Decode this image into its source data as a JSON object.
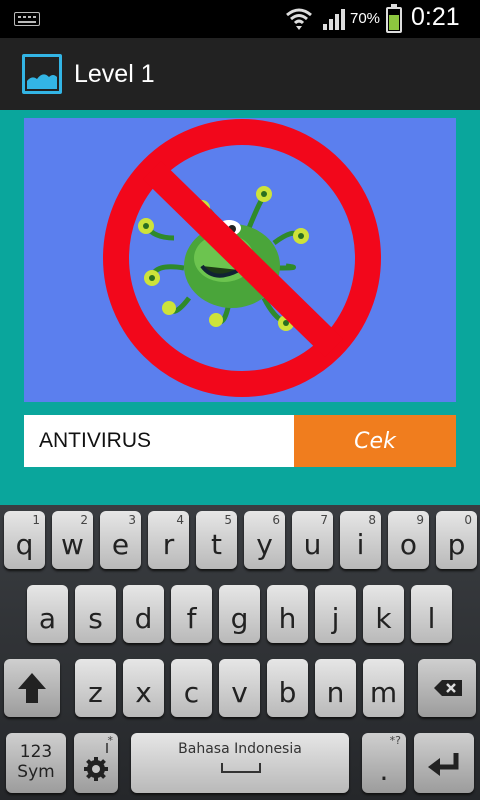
{
  "status_bar": {
    "battery_percent": "70%",
    "battery_level": 0.7,
    "time": "0:21",
    "icons": [
      "keyboard-icon",
      "wifi-icon",
      "signal-icon",
      "battery-icon"
    ]
  },
  "action_bar": {
    "title": "Level 1",
    "icon": "image-icon"
  },
  "puzzle": {
    "image": "no-virus-sign",
    "answer_value": "ANTIVIRUS",
    "check_label": "Cek",
    "colors": {
      "panel": "#5b7fee",
      "background": "#0aa69c",
      "button": "#f07d1e"
    }
  },
  "keyboard": {
    "row1": [
      {
        "ch": "q",
        "num": "1"
      },
      {
        "ch": "w",
        "num": "2"
      },
      {
        "ch": "e",
        "num": "3"
      },
      {
        "ch": "r",
        "num": "4"
      },
      {
        "ch": "t",
        "num": "5"
      },
      {
        "ch": "y",
        "num": "6"
      },
      {
        "ch": "u",
        "num": "7"
      },
      {
        "ch": "i",
        "num": "8"
      },
      {
        "ch": "o",
        "num": "9"
      },
      {
        "ch": "p",
        "num": "0"
      }
    ],
    "row2": [
      "a",
      "s",
      "d",
      "f",
      "g",
      "h",
      "j",
      "k",
      "l"
    ],
    "row3": [
      "z",
      "x",
      "c",
      "v",
      "b",
      "n",
      "m"
    ],
    "sym_label_1": "123",
    "sym_label_2": "Sym",
    "space_label": "Bahasa Indonesia",
    "period": ".",
    "settings_hint": "*",
    "period_hint": "*?"
  }
}
